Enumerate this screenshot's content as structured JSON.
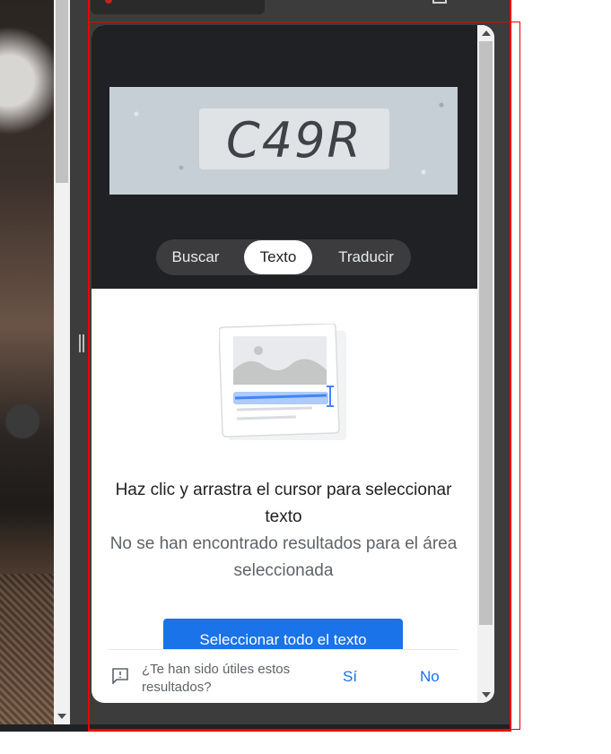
{
  "lens": {
    "captcha_text": "C49R",
    "tabs": {
      "search": "Buscar",
      "text": "Texto",
      "translate": "Traducir",
      "active": "Texto"
    },
    "instruction": "Haz clic y arrastra el cursor para seleccionar texto",
    "no_results": "No se han encontrado resultados para el área seleccionada",
    "select_all_button": "Seleccionar todo el texto",
    "feedback": {
      "question": "¿Te han sido útiles estos resultados?",
      "yes": "Sí",
      "no": "No"
    }
  },
  "colors": {
    "accent": "#1a73e8",
    "header_bg": "#202124",
    "panel_bg": "#3c3c3c"
  },
  "icons": [
    "feedback-icon",
    "text-select-illustration",
    "scroll-up-icon",
    "scroll-down-icon"
  ]
}
